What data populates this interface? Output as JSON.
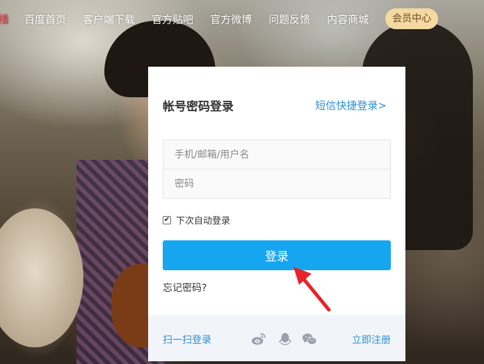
{
  "nav": {
    "partial_first": "播",
    "items": [
      "百度首页",
      "客户端下载",
      "官方贴吧",
      "官方微博",
      "问题反馈",
      "内容商城"
    ],
    "member_center": "会员中心"
  },
  "login": {
    "title": "帐号密码登录",
    "sms_link": "短信快捷登录>",
    "username_placeholder": "手机/邮箱/用户名",
    "password_placeholder": "密码",
    "remember_label": "下次自动登录",
    "remember_checked": true,
    "submit_label": "登录",
    "forgot_label": "忘记密码?"
  },
  "footer": {
    "qr_login": "扫一扫登录",
    "register": "立即注册",
    "social_icons": [
      "weibo-icon",
      "qq-icon",
      "wechat-icon"
    ]
  },
  "colors": {
    "accent": "#16a6f0",
    "link": "#2e8fd6",
    "member_bg": "#f4d9a2",
    "annotation_arrow": "#e8232a"
  }
}
